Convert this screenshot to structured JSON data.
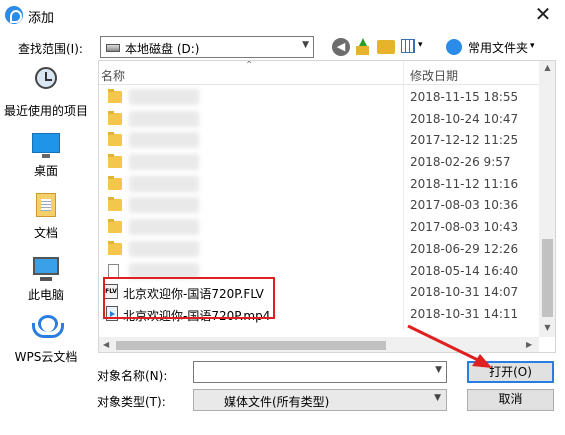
{
  "window": {
    "title": "添加",
    "close_glyph": "✕"
  },
  "toolbar": {
    "lookin_label": "查找范围(I):",
    "lookin_value": "本地磁盘 (D:)",
    "dropdown_glyph": "▼",
    "back_glyph": "◀",
    "view_arrow": "▾",
    "places_label": "常用文件夹",
    "places_arrow": "▾"
  },
  "sidebar": {
    "items": [
      {
        "label": "最近使用的项目",
        "icon": "recent-items-icon"
      },
      {
        "label": "桌面",
        "icon": "desktop-icon"
      },
      {
        "label": "文档",
        "icon": "documents-icon"
      },
      {
        "label": "此电脑",
        "icon": "this-pc-icon"
      },
      {
        "label": "WPS云文档",
        "icon": "wps-cloud-icon"
      }
    ]
  },
  "file_list": {
    "columns": {
      "name": "名称",
      "date": "修改日期"
    },
    "sort_glyph": "⌃",
    "rows": [
      {
        "type": "folder",
        "name": "",
        "date": "2018-11-15 18:55"
      },
      {
        "type": "folder",
        "name": "",
        "date": "2018-10-24 10:47"
      },
      {
        "type": "folder",
        "name": "",
        "date": "2017-12-12 11:25"
      },
      {
        "type": "folder",
        "name": "",
        "date": "2018-02-26 9:57"
      },
      {
        "type": "folder",
        "name": "",
        "date": "2018-11-12 11:16"
      },
      {
        "type": "folder",
        "name": "",
        "date": "2017-08-03 10:36"
      },
      {
        "type": "folder",
        "name": "",
        "date": "2017-08-03 10:43"
      },
      {
        "type": "folder",
        "name": "",
        "date": "2018-06-29 12:26"
      },
      {
        "type": "file",
        "name": "",
        "date": "2018-05-14 16:40"
      },
      {
        "type": "flv",
        "icon_text": "FLV",
        "name": "北京欢迎你-国语720P.FLV",
        "date": "2018-10-31 14:07"
      },
      {
        "type": "mp4",
        "name": "北京欢迎你-国语720P.mp4",
        "date": "2018-10-31 14:11"
      }
    ],
    "scroll_glyphs": {
      "up": "▲",
      "down": "▼",
      "left": "◀",
      "right": "▶"
    }
  },
  "form": {
    "filename_label": "对象名称(N):",
    "filename_value": "",
    "filetype_label": "对象类型(T):",
    "filetype_value": "媒体文件(所有类型)",
    "open_label": "打开(O)",
    "cancel_label": "取消"
  },
  "colors": {
    "highlight": "#e02020",
    "accent": "#2a7de0"
  }
}
